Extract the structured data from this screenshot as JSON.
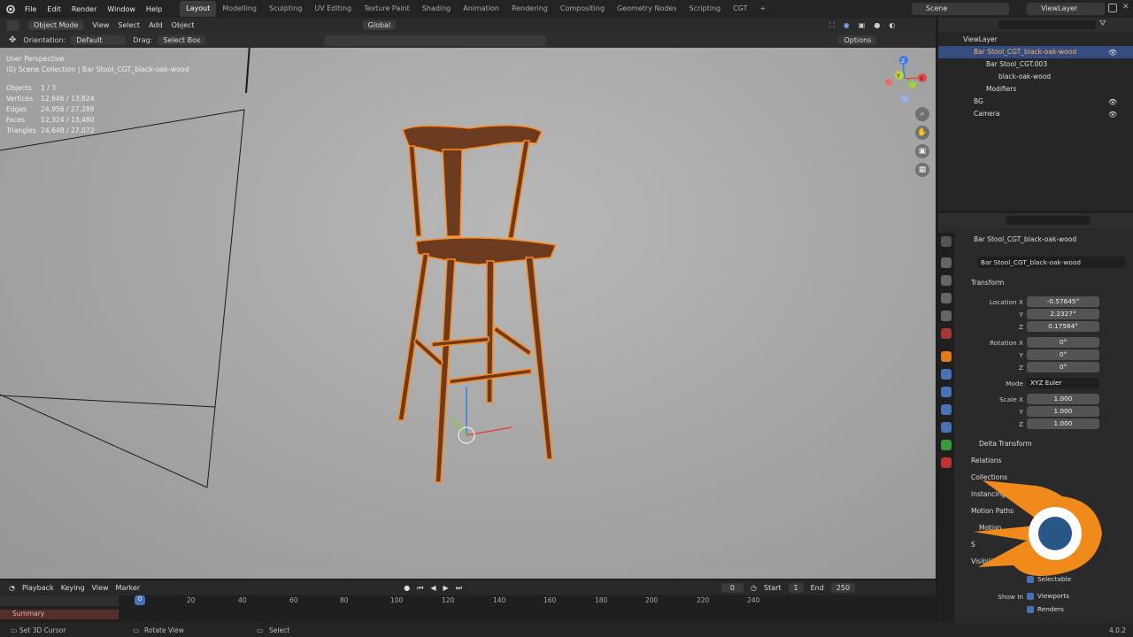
{
  "menu": {
    "items": [
      "File",
      "Edit",
      "Render",
      "Window",
      "Help"
    ]
  },
  "workspaces": [
    "Layout",
    "Modelling",
    "Sculpting",
    "UV Editing",
    "Texture Paint",
    "Shading",
    "Animation",
    "Rendering",
    "Compositing",
    "Geometry Nodes",
    "Scripting",
    "CGT"
  ],
  "scene_label": "Scene",
  "view_layer_label": "ViewLayer",
  "header": {
    "mode": "Object Mode",
    "menus": [
      "View",
      "Select",
      "Add",
      "Object"
    ],
    "transform": "Global",
    "orientation_label": "Orientation:",
    "orientation": "Default",
    "drag_label": "Drag:",
    "drag_value": "Select Box",
    "options": "Options"
  },
  "viewport": {
    "view_name": "User Perspective",
    "collection_path": "(0) Scene Collection | Bar Stool_CGT_black-oak-wood",
    "stats": [
      {
        "k": "Objects",
        "v": "1 / 3"
      },
      {
        "k": "Vertices",
        "v": "12,646 / 13,824"
      },
      {
        "k": "Edges",
        "v": "24,956 / 27,288"
      },
      {
        "k": "Faces",
        "v": "12,324 / 13,480"
      },
      {
        "k": "Triangles",
        "v": "24,648 / 27,072"
      }
    ],
    "axis_x": "X",
    "axis_y": "Y",
    "axis_z": "Z"
  },
  "outliner": {
    "rows": [
      {
        "label": "ViewLayer"
      },
      {
        "label": "Bar Stool_CGT_black-oak-wood"
      },
      {
        "label": "Bar Stool_CGT.003"
      },
      {
        "label": "black-oak-wood"
      },
      {
        "label": "Modifiers"
      },
      {
        "label": "BG"
      },
      {
        "label": "Camera"
      }
    ]
  },
  "properties": {
    "object_name": "Bar Stool_CGT_black-oak-wood",
    "object_name_field": "Bar Stool_CGT_black-oak-wood",
    "transform_label": "Transform",
    "location_label": "Location X",
    "location": [
      "-0.57645°",
      "2.2327°",
      "0.17564°"
    ],
    "rotation_label": "Rotation X",
    "rotation": [
      "0°",
      "0°",
      "0°"
    ],
    "mode_label": "Mode",
    "mode_value": "XYZ Euler",
    "scale_label": "Scale X",
    "scale": [
      "1.000",
      "1.000",
      "1.000"
    ],
    "y_label": "Y",
    "z_label": "Z",
    "sections": [
      "Delta Transform",
      "Relations",
      "Collections",
      "Instancing",
      "Motion Paths",
      "Motion",
      "S",
      "Visibility"
    ],
    "selectable": "Selectable",
    "show_in_label": "Show In",
    "viewports": "Viewports",
    "renders": "Renders"
  },
  "timeline": {
    "menus": [
      "Playback",
      "Keying",
      "View",
      "Marker"
    ],
    "current_frame": "0",
    "start_label": "Start",
    "start": "1",
    "end_label": "End",
    "end": "250",
    "ticks": [
      "0",
      "20",
      "40",
      "60",
      "80",
      "100",
      "120",
      "140",
      "160",
      "180",
      "200",
      "220",
      "240"
    ],
    "summary": "Summary"
  },
  "status": {
    "left": "Set 3D Cursor",
    "mid": "Rotate View",
    "right": "Select",
    "version": "4.0.2"
  },
  "colors": {
    "accent": "#4772b3",
    "selection": "#ff8a1c",
    "wood": "#6b3a1f"
  }
}
